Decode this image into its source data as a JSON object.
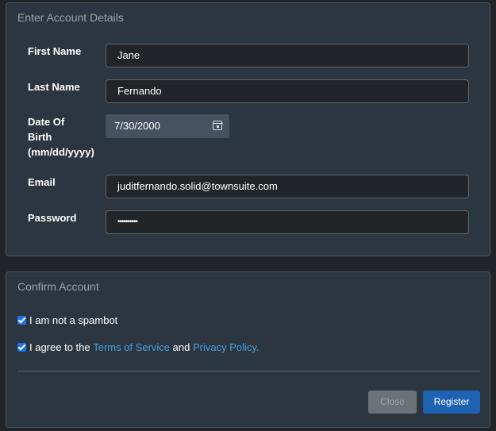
{
  "details": {
    "heading": "Enter Account Details",
    "first_name": {
      "label": "First Name",
      "value": "Jane"
    },
    "last_name": {
      "label": "Last Name",
      "value": "Fernando"
    },
    "dob": {
      "label_line1": "Date Of",
      "label_line2": "Birth",
      "label_line3": "(mm/dd/yyyy)",
      "value": "7/30/2000",
      "icon": "calendar-icon"
    },
    "email": {
      "label": "Email",
      "value": "juditfernando.solid@townsuite.com"
    },
    "password": {
      "label": "Password",
      "value": "••••••••••"
    }
  },
  "confirm": {
    "heading": "Confirm Account",
    "spambot": {
      "label": "I am not a spambot",
      "checked": true
    },
    "terms": {
      "prefix": "I agree to the ",
      "terms_link": "Terms of Service",
      "middle": " and ",
      "privacy_link": "Privacy Policy.",
      "checked": true
    },
    "close_label": "Close",
    "register_label": "Register"
  },
  "colors": {
    "background": "#212529",
    "panel": "#2b3640",
    "accent": "#1e62b3",
    "link": "#4a9fdf"
  }
}
